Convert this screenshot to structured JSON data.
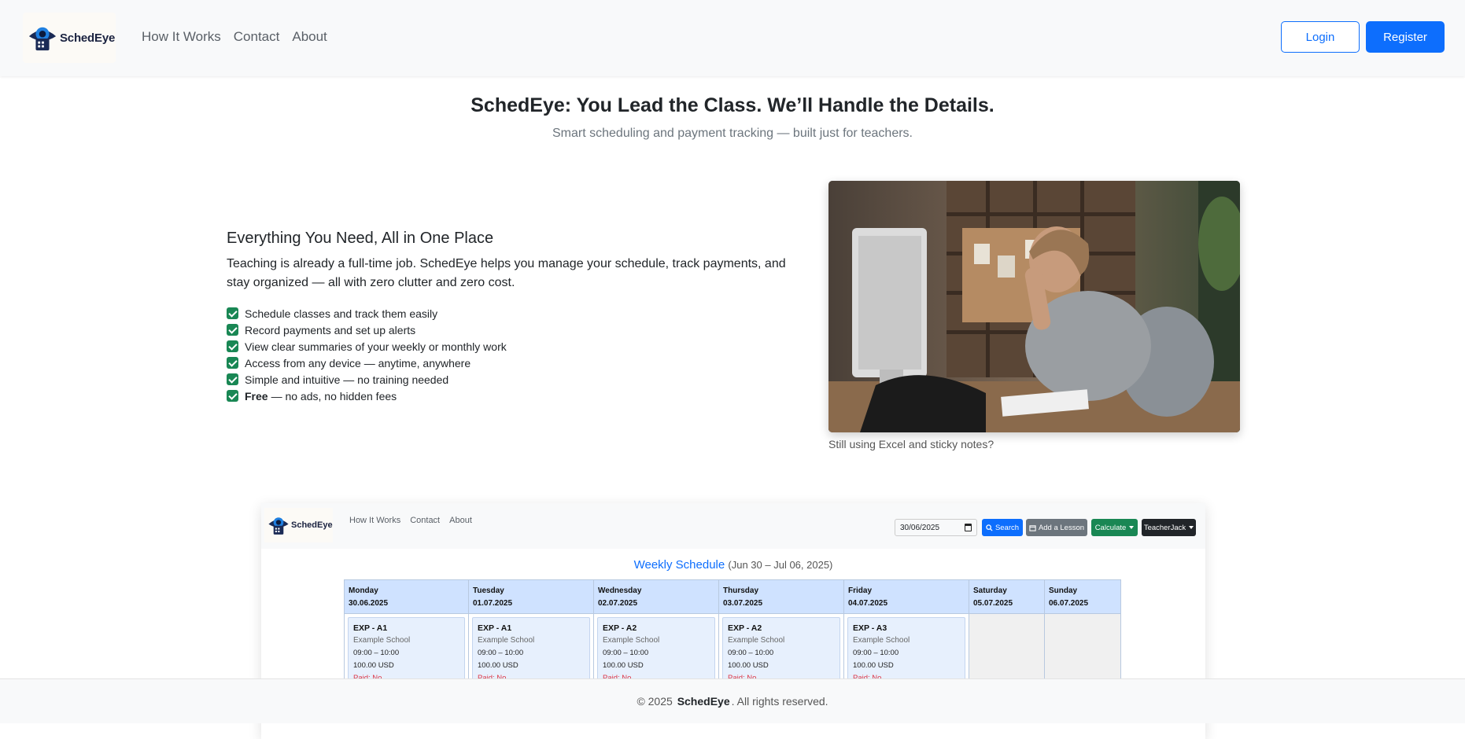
{
  "navbar": {
    "brand": "SchedEye",
    "links": [
      "How It Works",
      "Contact",
      "About"
    ],
    "login_label": "Login",
    "register_label": "Register"
  },
  "hero": {
    "title": "SchedEye: You Lead the Class. We’ll Handle the Details.",
    "subtitle": "Smart scheduling and payment tracking — built just for teachers."
  },
  "features": {
    "title": "Everything You Need, All in One Place",
    "description": "Teaching is already a full-time job. SchedEye helps you manage your schedule, track payments, and stay organized — all with zero clutter and zero cost.",
    "items": [
      {
        "bold": "",
        "text": "Schedule classes and track them easily"
      },
      {
        "bold": "",
        "text": "Record payments and set up alerts"
      },
      {
        "bold": "",
        "text": "View clear summaries of your weekly or monthly work"
      },
      {
        "bold": "",
        "text": "Access from any device — anytime, anywhere"
      },
      {
        "bold": "",
        "text": "Simple and intuitive — no training needed"
      },
      {
        "bold": "Free",
        "text": "— no ads, no hidden fees"
      }
    ]
  },
  "photo": {
    "caption": "Still using Excel and sticky notes?"
  },
  "preview": {
    "brand": "SchedEye",
    "links": [
      "How It Works",
      "Contact",
      "About"
    ],
    "date_value": "30/06/2025",
    "search_label": "Search",
    "add_label": "Add a Lesson",
    "calc_label": "Calculate",
    "user_label": "TeacherJack",
    "heading_main": "Weekly Schedule",
    "heading_range": "(Jun 30 – Jul 06, 2025)",
    "days": [
      {
        "name": "Monday",
        "date": "30.06.2025",
        "lesson": {
          "title": "EXP - A1",
          "school": "Example School",
          "time": "09:00 – 10:00",
          "price": "100.00 USD",
          "paid": "Paid: No"
        }
      },
      {
        "name": "Tuesday",
        "date": "01.07.2025",
        "lesson": {
          "title": "EXP - A1",
          "school": "Example School",
          "time": "09:00 – 10:00",
          "price": "100.00 USD",
          "paid": "Paid: No"
        }
      },
      {
        "name": "Wednesday",
        "date": "02.07.2025",
        "lesson": {
          "title": "EXP - A2",
          "school": "Example School",
          "time": "09:00 – 10:00",
          "price": "100.00 USD",
          "paid": "Paid: No"
        }
      },
      {
        "name": "Thursday",
        "date": "03.07.2025",
        "lesson": {
          "title": "EXP - A2",
          "school": "Example School",
          "time": "09:00 – 10:00",
          "price": "100.00 USD",
          "paid": "Paid: No"
        }
      },
      {
        "name": "Friday",
        "date": "04.07.2025",
        "lesson": {
          "title": "EXP - A3",
          "school": "Example School",
          "time": "09:00 – 10:00",
          "price": "100.00 USD",
          "paid": "Paid: No"
        }
      },
      {
        "name": "Saturday",
        "date": "05.07.2025",
        "lesson": null
      },
      {
        "name": "Sunday",
        "date": "06.07.2025",
        "lesson": null
      }
    ]
  },
  "footer": {
    "prefix": "© 2025",
    "brand": "SchedEye",
    "suffix": ". All rights reserved."
  },
  "colors": {
    "primary": "#0d6efd",
    "success": "#198754",
    "secondary": "#6c757d",
    "dark": "#212529",
    "danger": "#dc3545"
  }
}
